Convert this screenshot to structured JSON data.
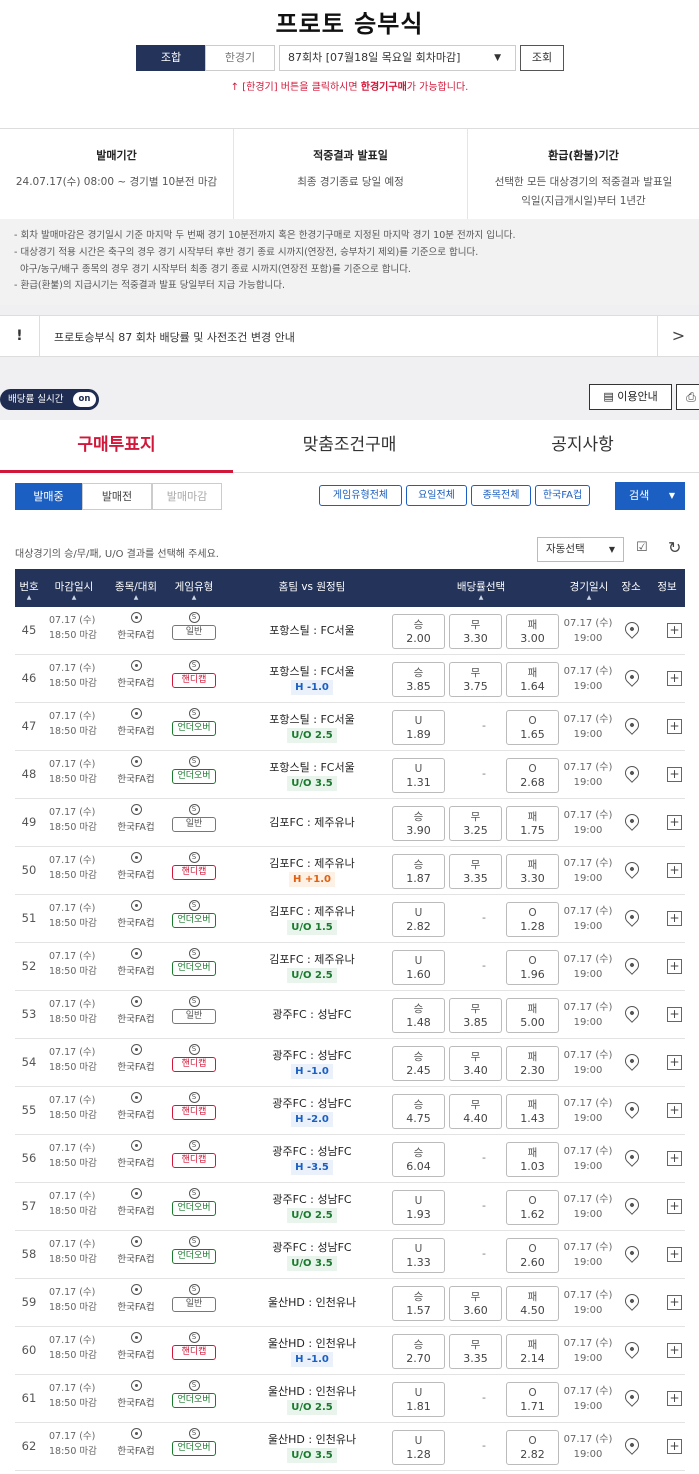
{
  "title": "프로토 승부식",
  "mode_tabs": {
    "combo": "조합",
    "single": "한경기"
  },
  "round_select": "87회차 [07월18일 목요일 회차마감]",
  "search_button": "조회",
  "hint": {
    "prefix": "↑ [한경기] 버튼을 클릭하시면 ",
    "strong": "한경기구매",
    "suffix": "가 가능합니다."
  },
  "info": [
    {
      "heading": "발매기간",
      "value": "24.07.17(수) 08:00 ~ 경기별 10분전 마감"
    },
    {
      "heading": "적중결과 발표일",
      "value": "최종 경기종료 당일 예정"
    },
    {
      "heading": "환급(환불)기간",
      "value": "선택한 모든 대상경기의 적중결과 발표일",
      "value2": "익일(지급개시일)부터 1년간"
    }
  ],
  "notes": [
    "- 회차 발매마감은 경기일시 기준 마지막 두 번째 경기 10분전까지 혹은 한경기구매로 지정된 마지막 경기 10분 전까지 입니다.",
    "- 대상경기 적용 시간은 축구의 경우 경기 시작부터 후반 경기 종료 시까지(연장전, 승부차기 제외)를 기준으로 합니다.",
    "  야구/농구/배구 종목의 경우 경기 시작부터 최종 경기 종료 시까지(연장전 포함)를 기준으로 합니다.",
    "- 환급(환불)의 지급시기는 적중결과 발표 당일부터 지급 가능합니다."
  ],
  "notice": "프로토승부식 87 회차 배당률 및 사전조건 변경 안내",
  "realtime": {
    "label": "배당률 실시간",
    "state": "on"
  },
  "guide_button": "이용안내",
  "main_tabs": [
    "구매투표지",
    "맞춤조건구매",
    "공지사항"
  ],
  "status_tabs": [
    "발매중",
    "발매전",
    "발매마감"
  ],
  "filters": [
    "게임유형전체",
    "요일전체",
    "종목전체",
    "한국FA컵"
  ],
  "search2": "검색",
  "select_label": "대상경기의 승/무/패, U/O 결과를 선택해 주세요.",
  "auto_select": "자동선택",
  "columns": [
    "번호",
    "마감일시",
    "종목/대회",
    "게임유형",
    "홈팀 vs 원정팀",
    "배당률선택",
    "경기일시",
    "장소",
    "정보"
  ],
  "rows": [
    {
      "no": "45",
      "date": "07.17 (수)",
      "close": "18:50 마감",
      "comp": "한국FA컵",
      "type": "일반",
      "tc": "g",
      "match": "포항스틸 : FC서울",
      "hc": "",
      "hct": "",
      "o1l": "승",
      "o1": "2.00",
      "o2l": "무",
      "o2": "3.30",
      "o3l": "패",
      "o3": "3.00",
      "gdate": "07.17 (수)",
      "gtime": "19:00"
    },
    {
      "no": "46",
      "date": "07.17 (수)",
      "close": "18:50 마감",
      "comp": "한국FA컵",
      "type": "핸디캡",
      "tc": "h",
      "match": "포항스틸 : FC서울",
      "hc": "H -1.0",
      "hct": "H",
      "o1l": "승",
      "o1": "3.85",
      "o2l": "무",
      "o2": "3.75",
      "o3l": "패",
      "o3": "1.64",
      "gdate": "07.17 (수)",
      "gtime": "19:00"
    },
    {
      "no": "47",
      "date": "07.17 (수)",
      "close": "18:50 마감",
      "comp": "한국FA컵",
      "type": "언더오버",
      "tc": "u",
      "match": "포항스틸 : FC서울",
      "hc": "U/O 2.5",
      "hct": "UO",
      "o1l": "U",
      "o1": "1.89",
      "o2l": "",
      "o2": "",
      "o3l": "O",
      "o3": "1.65",
      "gdate": "07.17 (수)",
      "gtime": "19:00"
    },
    {
      "no": "48",
      "date": "07.17 (수)",
      "close": "18:50 마감",
      "comp": "한국FA컵",
      "type": "언더오버",
      "tc": "u",
      "match": "포항스틸 : FC서울",
      "hc": "U/O 3.5",
      "hct": "UO",
      "o1l": "U",
      "o1": "1.31",
      "o2l": "",
      "o2": "",
      "o3l": "O",
      "o3": "2.68",
      "gdate": "07.17 (수)",
      "gtime": "19:00"
    },
    {
      "no": "49",
      "date": "07.17 (수)",
      "close": "18:50 마감",
      "comp": "한국FA컵",
      "type": "일반",
      "tc": "g",
      "match": "김포FC : 제주유나",
      "hc": "",
      "hct": "",
      "o1l": "승",
      "o1": "3.90",
      "o2l": "무",
      "o2": "3.25",
      "o3l": "패",
      "o3": "1.75",
      "gdate": "07.17 (수)",
      "gtime": "19:00"
    },
    {
      "no": "50",
      "date": "07.17 (수)",
      "close": "18:50 마감",
      "comp": "한국FA컵",
      "type": "핸디캡",
      "tc": "h",
      "match": "김포FC : 제주유나",
      "hc": "H +1.0",
      "hct": "Hp",
      "o1l": "승",
      "o1": "1.87",
      "o2l": "무",
      "o2": "3.35",
      "o3l": "패",
      "o3": "3.30",
      "gdate": "07.17 (수)",
      "gtime": "19:00"
    },
    {
      "no": "51",
      "date": "07.17 (수)",
      "close": "18:50 마감",
      "comp": "한국FA컵",
      "type": "언더오버",
      "tc": "u",
      "match": "김포FC : 제주유나",
      "hc": "U/O 1.5",
      "hct": "UO",
      "o1l": "U",
      "o1": "2.82",
      "o2l": "",
      "o2": "",
      "o3l": "O",
      "o3": "1.28",
      "gdate": "07.17 (수)",
      "gtime": "19:00"
    },
    {
      "no": "52",
      "date": "07.17 (수)",
      "close": "18:50 마감",
      "comp": "한국FA컵",
      "type": "언더오버",
      "tc": "u",
      "match": "김포FC : 제주유나",
      "hc": "U/O 2.5",
      "hct": "UO",
      "o1l": "U",
      "o1": "1.60",
      "o2l": "",
      "o2": "",
      "o3l": "O",
      "o3": "1.96",
      "gdate": "07.17 (수)",
      "gtime": "19:00"
    },
    {
      "no": "53",
      "date": "07.17 (수)",
      "close": "18:50 마감",
      "comp": "한국FA컵",
      "type": "일반",
      "tc": "g",
      "match": "광주FC : 성남FC",
      "hc": "",
      "hct": "",
      "o1l": "승",
      "o1": "1.48",
      "o2l": "무",
      "o2": "3.85",
      "o3l": "패",
      "o3": "5.00",
      "gdate": "07.17 (수)",
      "gtime": "19:00"
    },
    {
      "no": "54",
      "date": "07.17 (수)",
      "close": "18:50 마감",
      "comp": "한국FA컵",
      "type": "핸디캡",
      "tc": "h",
      "match": "광주FC : 성남FC",
      "hc": "H -1.0",
      "hct": "H",
      "o1l": "승",
      "o1": "2.45",
      "o2l": "무",
      "o2": "3.40",
      "o3l": "패",
      "o3": "2.30",
      "gdate": "07.17 (수)",
      "gtime": "19:00"
    },
    {
      "no": "55",
      "date": "07.17 (수)",
      "close": "18:50 마감",
      "comp": "한국FA컵",
      "type": "핸디캡",
      "tc": "h",
      "match": "광주FC : 성남FC",
      "hc": "H -2.0",
      "hct": "H",
      "o1l": "승",
      "o1": "4.75",
      "o2l": "무",
      "o2": "4.40",
      "o3l": "패",
      "o3": "1.43",
      "gdate": "07.17 (수)",
      "gtime": "19:00"
    },
    {
      "no": "56",
      "date": "07.17 (수)",
      "close": "18:50 마감",
      "comp": "한국FA컵",
      "type": "핸디캡",
      "tc": "h",
      "match": "광주FC : 성남FC",
      "hc": "H -3.5",
      "hct": "H",
      "o1l": "승",
      "o1": "6.04",
      "o2l": "",
      "o2": "",
      "o3l": "패",
      "o3": "1.03",
      "gdate": "07.17 (수)",
      "gtime": "19:00"
    },
    {
      "no": "57",
      "date": "07.17 (수)",
      "close": "18:50 마감",
      "comp": "한국FA컵",
      "type": "언더오버",
      "tc": "u",
      "match": "광주FC : 성남FC",
      "hc": "U/O 2.5",
      "hct": "UO",
      "o1l": "U",
      "o1": "1.93",
      "o2l": "",
      "o2": "",
      "o3l": "O",
      "o3": "1.62",
      "gdate": "07.17 (수)",
      "gtime": "19:00"
    },
    {
      "no": "58",
      "date": "07.17 (수)",
      "close": "18:50 마감",
      "comp": "한국FA컵",
      "type": "언더오버",
      "tc": "u",
      "match": "광주FC : 성남FC",
      "hc": "U/O 3.5",
      "hct": "UO",
      "o1l": "U",
      "o1": "1.33",
      "o2l": "",
      "o2": "",
      "o3l": "O",
      "o3": "2.60",
      "gdate": "07.17 (수)",
      "gtime": "19:00"
    },
    {
      "no": "59",
      "date": "07.17 (수)",
      "close": "18:50 마감",
      "comp": "한국FA컵",
      "type": "일반",
      "tc": "g",
      "match": "울산HD : 인천유나",
      "hc": "",
      "hct": "",
      "o1l": "승",
      "o1": "1.57",
      "o2l": "무",
      "o2": "3.60",
      "o3l": "패",
      "o3": "4.50",
      "gdate": "07.17 (수)",
      "gtime": "19:00"
    },
    {
      "no": "60",
      "date": "07.17 (수)",
      "close": "18:50 마감",
      "comp": "한국FA컵",
      "type": "핸디캡",
      "tc": "h",
      "match": "울산HD : 인천유나",
      "hc": "H -1.0",
      "hct": "H",
      "o1l": "승",
      "o1": "2.70",
      "o2l": "무",
      "o2": "3.35",
      "o3l": "패",
      "o3": "2.14",
      "gdate": "07.17 (수)",
      "gtime": "19:00"
    },
    {
      "no": "61",
      "date": "07.17 (수)",
      "close": "18:50 마감",
      "comp": "한국FA컵",
      "type": "언더오버",
      "tc": "u",
      "match": "울산HD : 인천유나",
      "hc": "U/O 2.5",
      "hct": "UO",
      "o1l": "U",
      "o1": "1.81",
      "o2l": "",
      "o2": "",
      "o3l": "O",
      "o3": "1.71",
      "gdate": "07.17 (수)",
      "gtime": "19:00"
    },
    {
      "no": "62",
      "date": "07.17 (수)",
      "close": "18:50 마감",
      "comp": "한국FA컵",
      "type": "언더오버",
      "tc": "u",
      "match": "울산HD : 인천유나",
      "hc": "U/O 3.5",
      "hct": "UO",
      "o1l": "U",
      "o1": "1.28",
      "o2l": "",
      "o2": "",
      "o3l": "O",
      "o3": "2.82",
      "gdate": "07.17 (수)",
      "gtime": "19:00"
    }
  ]
}
